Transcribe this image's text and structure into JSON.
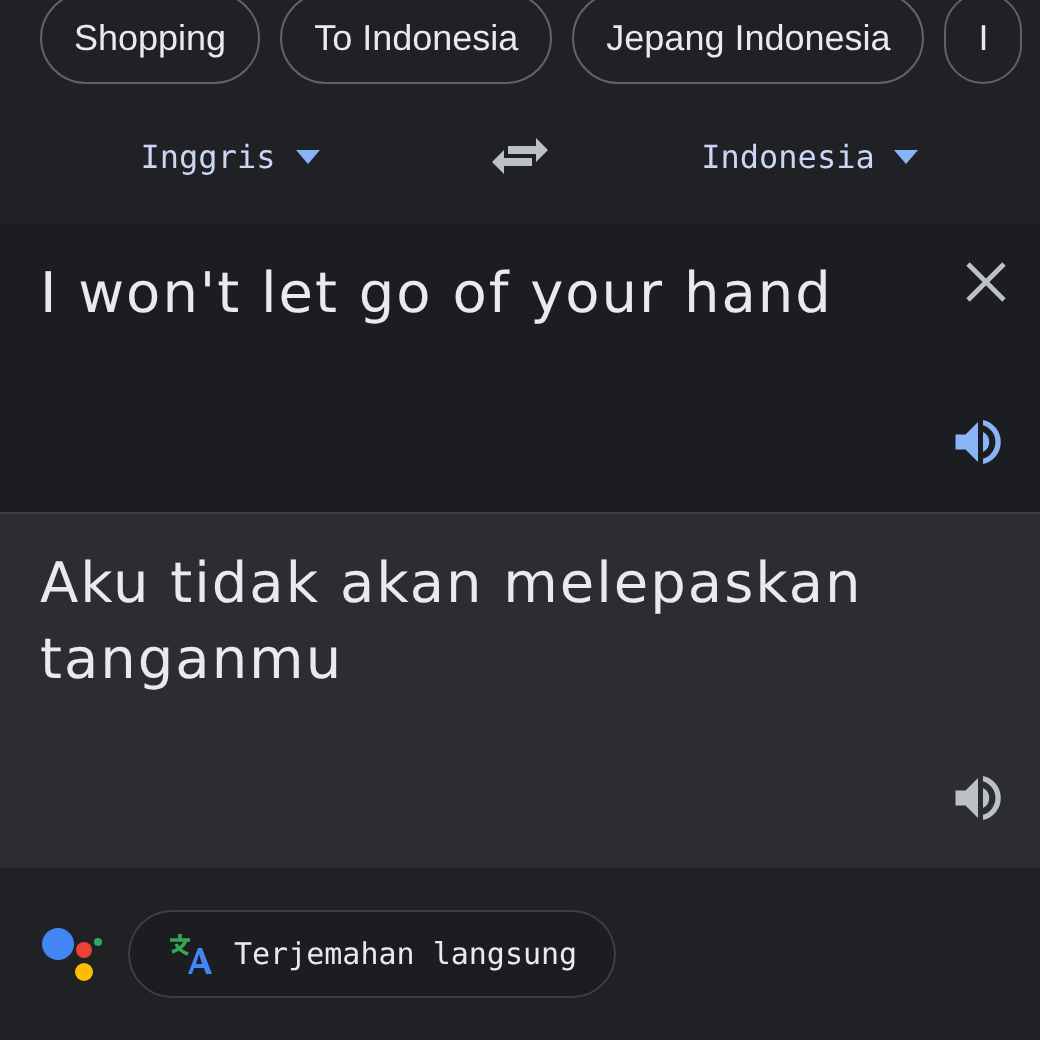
{
  "chips": [
    {
      "label": "Shopping"
    },
    {
      "label": "To Indonesia"
    },
    {
      "label": "Jepang Indonesia"
    },
    {
      "label": "I"
    }
  ],
  "languages": {
    "source": "Inggris",
    "target": "Indonesia"
  },
  "source": {
    "text": "I won't let go of your hand",
    "speaker_active": true
  },
  "result": {
    "text": "Aku tidak akan melepaskan tanganmu",
    "speaker_active": false
  },
  "live_button": {
    "label": "Terjemahan langsung"
  }
}
